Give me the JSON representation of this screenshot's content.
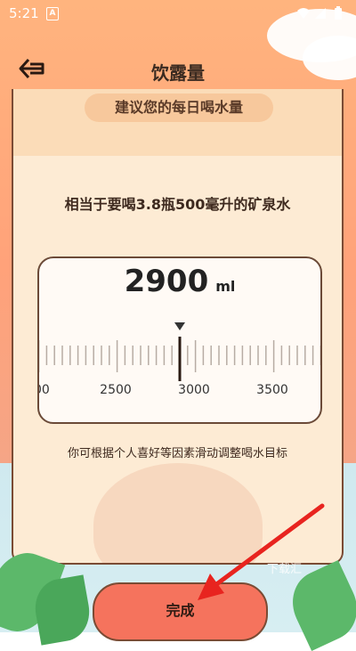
{
  "status_bar": {
    "time": "5:21",
    "badge": "A",
    "icons": [
      "wifi-icon",
      "signal-icon",
      "battery-icon"
    ]
  },
  "header": {
    "title": "饮露量",
    "back_icon": "back-arrow-icon"
  },
  "card": {
    "pill_text": "建议您的每日喝水量",
    "equivalent_text": "相当于要喝3.8瓶500毫升的矿泉水",
    "hint_text": "你可根据个人喜好等因素滑动调整喝水目标"
  },
  "ruler": {
    "value": "2900",
    "unit": "ml",
    "current": 2900,
    "labels": [
      "00",
      "2500",
      "3000",
      "3500"
    ]
  },
  "footer": {
    "done_label": "完成",
    "watermark": "下载汇"
  },
  "colors": {
    "accent_button": "#f5735d",
    "card_bg": "#fdebd4",
    "border": "#7a4b34",
    "annotation_arrow": "#e8241f"
  }
}
